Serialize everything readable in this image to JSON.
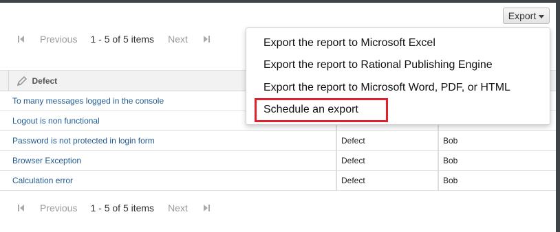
{
  "export_button": {
    "label": "Export",
    "icon": "caret-down-icon"
  },
  "pager_top": {
    "previous": "Previous",
    "range": "1 - 5 of 5 items",
    "next": "Next"
  },
  "pager_bottom": {
    "previous": "Previous",
    "range": "1 - 5 of 5 items",
    "next": "Next"
  },
  "table": {
    "header": {
      "column_title": "Defect",
      "icon": "pencil-icon"
    },
    "rows": [
      {
        "title": "To many messages logged in the console",
        "type": "",
        "owner": ""
      },
      {
        "title": "Logout is non functional",
        "type": "",
        "owner": ""
      },
      {
        "title": "Password is not protected in login form",
        "type": "Defect",
        "owner": "Bob"
      },
      {
        "title": "Browser Exception",
        "type": "Defect",
        "owner": "Bob"
      },
      {
        "title": "Calculation error",
        "type": "Defect",
        "owner": "Bob"
      }
    ]
  },
  "export_menu": {
    "items": [
      {
        "label": "Export the report to Microsoft Excel"
      },
      {
        "label": "Export the report to Rational Publishing Engine"
      },
      {
        "label": "Export the report to Microsoft Word, PDF, or HTML"
      },
      {
        "label": "Schedule an export"
      }
    ],
    "highlighted_index": 3,
    "highlight_color": "#e0202a"
  },
  "colors": {
    "link": "#1f5a91",
    "chrome": "#3e4348"
  }
}
